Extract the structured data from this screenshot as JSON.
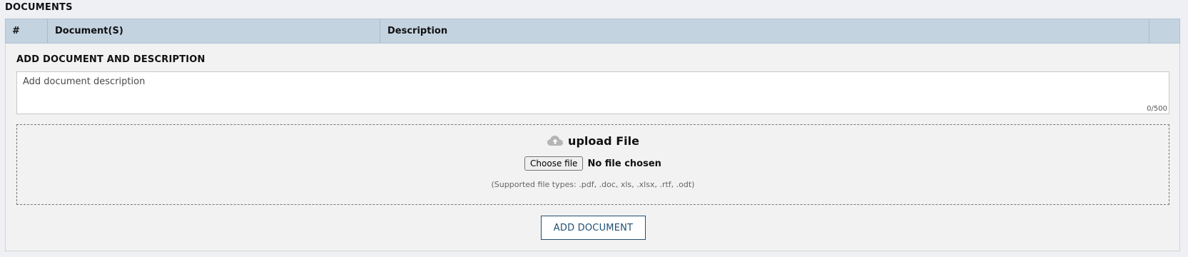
{
  "section": {
    "title": "DOCUMENTS"
  },
  "table": {
    "columns": [
      "#",
      "Document(S)",
      "Description",
      ""
    ]
  },
  "add_panel": {
    "title": "ADD DOCUMENT AND DESCRIPTION",
    "description": {
      "placeholder": "Add document description",
      "value": "",
      "char_count": "0/500"
    },
    "upload": {
      "icon": "cloud-upload-icon",
      "heading": "upload File",
      "choose_button_label": "Choose file",
      "file_status": "No file chosen",
      "supported_types": "(Supported file types: .pdf, .doc, xls, .xlsx, .rtf, .odt)"
    },
    "add_button_label": "ADD DOCUMENT"
  },
  "colors": {
    "page_bg": "#eef0f4",
    "header_bg": "#c4d3e0",
    "panel_bg": "#f2f2f2",
    "accent": "#1e4f74"
  }
}
